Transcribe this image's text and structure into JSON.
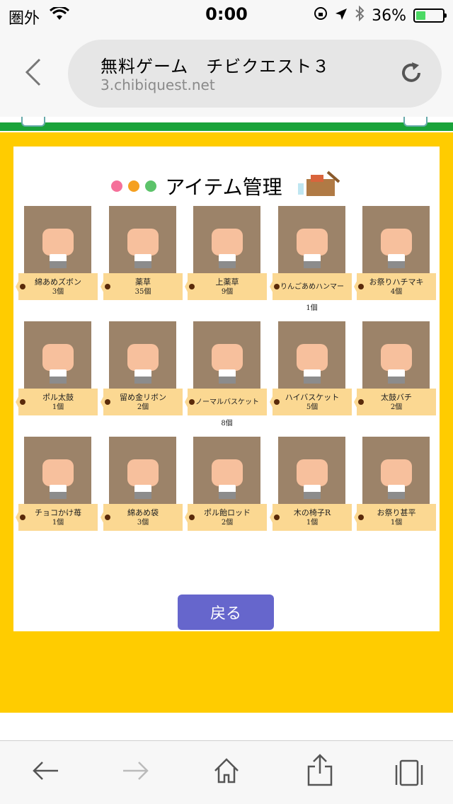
{
  "status": {
    "carrier": "圏外",
    "time": "0:00",
    "battery_percent": "36%",
    "battery_level": 0.36,
    "battery_color": "#4cd964"
  },
  "browser": {
    "page_title": "無料ゲーム　チビクエスト３",
    "host": "3.chibiquest.net"
  },
  "page": {
    "heading": "アイテム管理",
    "frame_color": "#ffcc00",
    "back_button_label": "戻る",
    "back_button_color": "#6666cc"
  },
  "items": [
    {
      "name": "綿あめズボン",
      "count": "3個"
    },
    {
      "name": "薬草",
      "count": "35個"
    },
    {
      "name": "上薬草",
      "count": "9個"
    },
    {
      "name": "りんごあめハンマー",
      "count": "1個"
    },
    {
      "name": "お祭りハチマキ",
      "count": "4個"
    },
    {
      "name": "ポル太鼓",
      "count": "1個"
    },
    {
      "name": "留め金リボン",
      "count": "2個"
    },
    {
      "name": "ノーマルバスケット",
      "count": "8個"
    },
    {
      "name": "ハイバスケット",
      "count": "5個"
    },
    {
      "name": "太鼓バチ",
      "count": "2個"
    },
    {
      "name": "チョコかけ苺",
      "count": "1個"
    },
    {
      "name": "綿あめ袋",
      "count": "3個"
    },
    {
      "name": "ポル飴ロッド",
      "count": "2個"
    },
    {
      "name": "木の椅子R",
      "count": "1個"
    },
    {
      "name": "お祭り甚平",
      "count": "1個"
    }
  ],
  "toolbar": {
    "icons": [
      "back-arrow-icon",
      "forward-arrow-icon",
      "home-icon",
      "share-icon",
      "tabs-icon"
    ]
  }
}
